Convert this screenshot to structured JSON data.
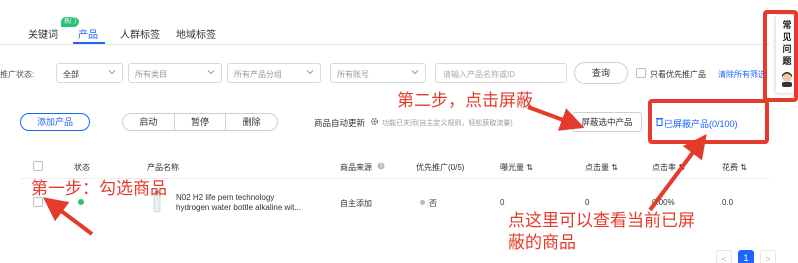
{
  "tabs": [
    {
      "label": "关键词",
      "badge": "热门"
    },
    {
      "label": "产品"
    },
    {
      "label": "人群标签"
    },
    {
      "label": "地域标签"
    }
  ],
  "filters": {
    "status_label": "推广状态:",
    "status_value": "全部",
    "category_placeholder": "所有类目",
    "group_placeholder": "所有产品分组",
    "account_placeholder": "所有账号",
    "search_placeholder": "请输入产品名称或ID",
    "query_button": "查询",
    "priority_only_label": "只看优先推广品",
    "clear_all": "清除所有筛选"
  },
  "actions": {
    "add_product": "添加产品",
    "enable": "启动",
    "pause": "暂停",
    "delete": "删除",
    "auto_update_label": "商品自动更新",
    "auto_update_hint": "功能已关闭(自主定义规则，轻松获取流量)",
    "shield_selected": "屏蔽选中产品",
    "shielded_products": "已屏蔽产品(0/100)"
  },
  "table": {
    "headers": {
      "status": "状态",
      "name": "产品名称",
      "source": "商品来源",
      "priority": "优先推广(0/5)",
      "impressions": "曝光量 ⇅",
      "clicks": "点击量 ⇅",
      "ctr": "点击率 ⇅",
      "cost": "花费 ⇅"
    },
    "rows": [
      {
        "name_line1": "N02 H2 life pem technology",
        "name_line2": "hydrogen water bottle alkaline wit...",
        "source": "自主添加",
        "priority": "否",
        "impressions": "0",
        "clicks": "0",
        "ctr": "0.00%",
        "cost": "0.0"
      }
    ]
  },
  "help_widget": {
    "text": "常见问题"
  },
  "pagination": {
    "prev": "<",
    "current": "1",
    "next": ">"
  },
  "annotations": {
    "step1": "第一步：勾选商品",
    "step2": "第二步，点击屏蔽",
    "note": "点这里可以查看当前已屏蔽的商品"
  },
  "colors": {
    "accent": "#1a66ff",
    "annotation": "#e53b2c",
    "status_on": "#2bc275"
  }
}
